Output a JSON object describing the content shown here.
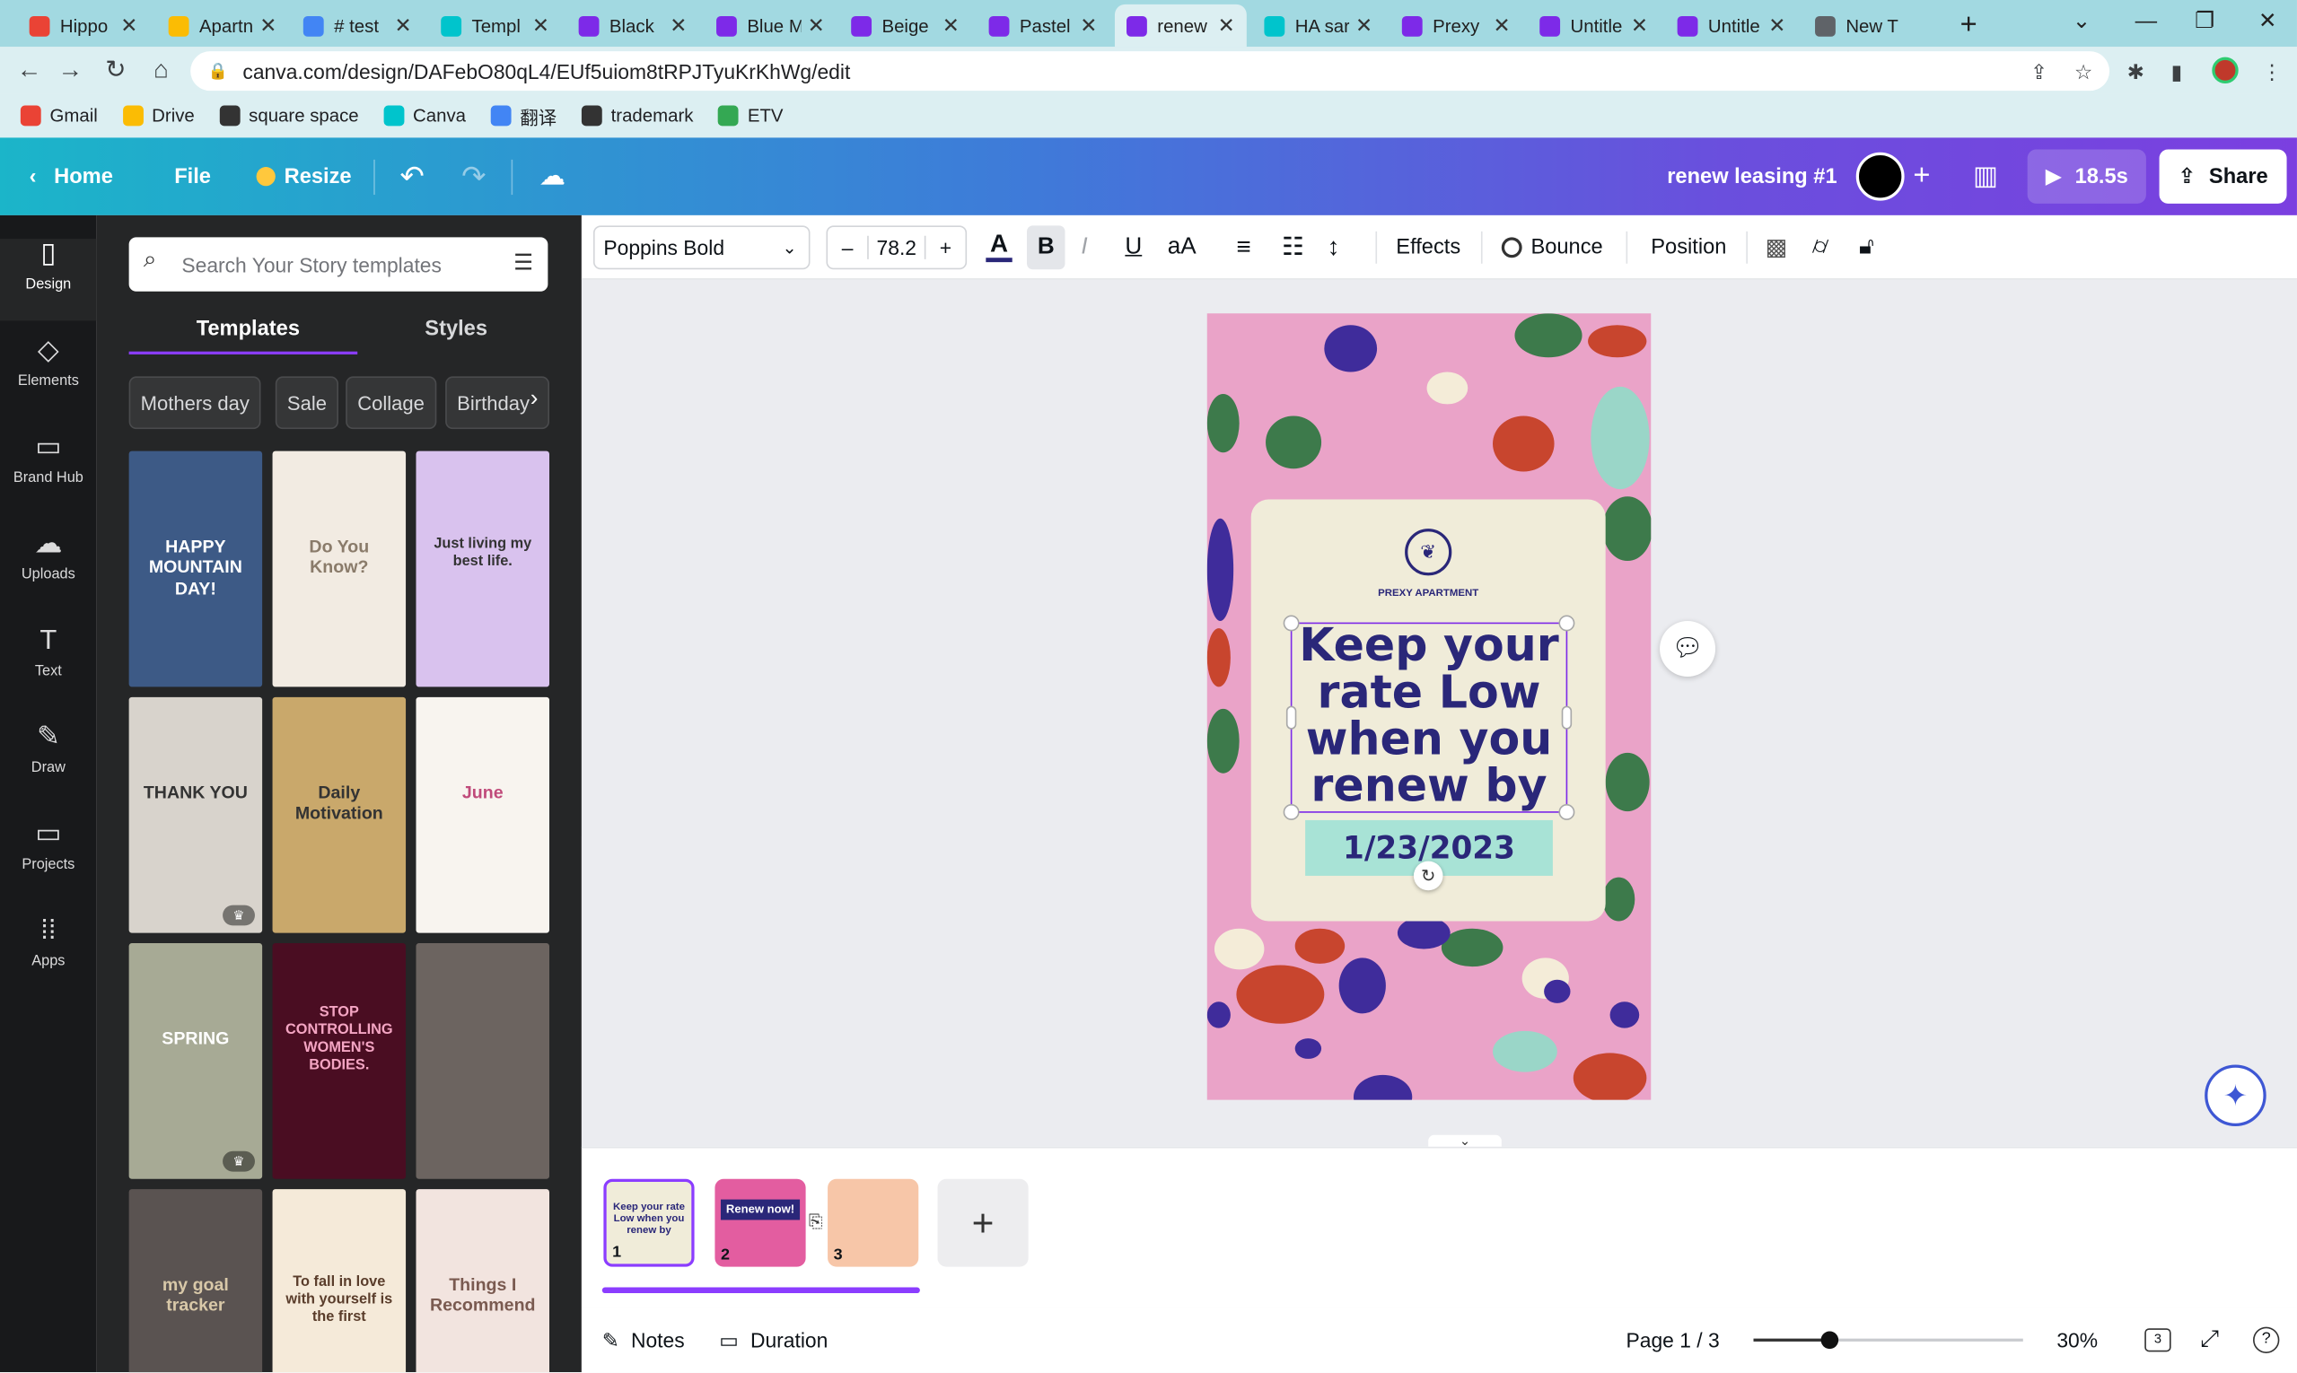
{
  "browser": {
    "tabs": [
      {
        "title": "Hippo",
        "icon": "gmail-icon",
        "color": "#ea4335"
      },
      {
        "title": "Apartn",
        "icon": "drive-icon",
        "color": "#fbbc04"
      },
      {
        "title": "# test",
        "icon": "docs-icon",
        "color": "#4285f4"
      },
      {
        "title": "Templ",
        "icon": "canva-icon",
        "color": "#00c4cc"
      },
      {
        "title": "Black",
        "icon": "canva-doc-icon",
        "color": "#7d2ae8"
      },
      {
        "title": "Blue M",
        "icon": "canva-doc-icon",
        "color": "#7d2ae8"
      },
      {
        "title": "Beige",
        "icon": "canva-doc-icon",
        "color": "#7d2ae8"
      },
      {
        "title": "Pastel",
        "icon": "canva-doc-icon",
        "color": "#7d2ae8"
      },
      {
        "title": "renew",
        "icon": "canva-design-icon",
        "color": "#7d2ae8"
      },
      {
        "title": "HA sar",
        "icon": "canva-icon",
        "color": "#00c4cc"
      },
      {
        "title": "Prexy",
        "icon": "canva-design-icon",
        "color": "#7d2ae8"
      },
      {
        "title": "Untitle",
        "icon": "canva-design-icon",
        "color": "#7d2ae8"
      },
      {
        "title": "Untitle",
        "icon": "canva-design-icon",
        "color": "#7d2ae8"
      },
      {
        "title": "New T",
        "icon": "chrome-icon",
        "color": "#5f6368"
      }
    ],
    "active_tab_index": 8,
    "url": "canva.com/design/DAFebO80qL4/EUf5uiom8tRPJTyuKrKhWg/edit",
    "bookmarks": [
      {
        "label": "Gmail",
        "color": "#ea4335"
      },
      {
        "label": "Drive",
        "color": "#fbbc04"
      },
      {
        "label": "square space",
        "color": "#333333"
      },
      {
        "label": "Canva",
        "color": "#00c4cc"
      },
      {
        "label": "翻译",
        "color": "#4285f4"
      },
      {
        "label": "trademark",
        "color": "#333333"
      },
      {
        "label": "ETV",
        "color": "#34a853"
      }
    ]
  },
  "header": {
    "home": "Home",
    "file": "File",
    "resize": "Resize",
    "design_title": "renew leasing #1",
    "play_duration": "18.5s",
    "share": "Share"
  },
  "rail": [
    {
      "label": "Design",
      "icon": "layout-icon",
      "glyph": "▯"
    },
    {
      "label": "Elements",
      "icon": "shapes-icon",
      "glyph": "◇"
    },
    {
      "label": "Brand Hub",
      "icon": "brand-icon",
      "glyph": "▭"
    },
    {
      "label": "Uploads",
      "icon": "cloud-upload-icon",
      "glyph": "☁"
    },
    {
      "label": "Text",
      "icon": "text-t-icon",
      "glyph": "T"
    },
    {
      "label": "Draw",
      "icon": "pen-icon",
      "glyph": "✎"
    },
    {
      "label": "Projects",
      "icon": "folder-icon",
      "glyph": "▭"
    },
    {
      "label": "Apps",
      "icon": "apps-grid-icon",
      "glyph": "⁞⁞"
    }
  ],
  "panel": {
    "search_placeholder": "Search Your Story templates",
    "tabs": [
      "Templates",
      "Styles"
    ],
    "chips": [
      "Mothers day",
      "Sale",
      "Collage",
      "Birthday"
    ],
    "templates": [
      {
        "name": "happy-mountain-day",
        "bg": "#3d5a86",
        "text": "HAPPY MOUNTAIN DAY!",
        "fg": "#ffffff",
        "crown": false
      },
      {
        "name": "do-you-know",
        "bg": "#f2ebe2",
        "text": "Do You Know?",
        "fg": "#8a7b6a",
        "crown": false
      },
      {
        "name": "just-living-my-best-life",
        "bg": "#d9c2ee",
        "text": "Just living my best life.",
        "fg": "#333333",
        "crown": false
      },
      {
        "name": "thank-you-my-friends",
        "bg": "#d8d3cc",
        "text": "THANK YOU",
        "fg": "#333333",
        "crown": true
      },
      {
        "name": "daily-motivation",
        "bg": "#c9a86b",
        "text": "Daily Motivation",
        "fg": "#333333",
        "crown": false
      },
      {
        "name": "june-calendar",
        "bg": "#f8f4ef",
        "text": "June",
        "fg": "#c04a7a",
        "crown": false
      },
      {
        "name": "spring-sale",
        "bg": "#a7aa95",
        "text": "SPRING",
        "fg": "#ffffff",
        "crown": true
      },
      {
        "name": "stop-controlling",
        "bg": "#4a0d22",
        "text": "STOP CONTROLLING WOMEN'S BODIES.",
        "fg": "#f4a5c3",
        "crown": false
      },
      {
        "name": "floral-quote",
        "bg": "#6c6460",
        "text": "",
        "fg": "#ffffff",
        "crown": false
      },
      {
        "name": "my-goal-tracker",
        "bg": "#5a5351",
        "text": "my goal tracker",
        "fg": "#d8c8a8",
        "crown": false
      },
      {
        "name": "fall-in-love",
        "bg": "#f5ead9",
        "text": "To fall in love with yourself is the first",
        "fg": "#5a3d2b",
        "crown": false
      },
      {
        "name": "things-i-recommend",
        "bg": "#f2e4df",
        "text": "Things I Recommend",
        "fg": "#7a5a50",
        "crown": false
      }
    ]
  },
  "toolbar": {
    "font": "Poppins Bold",
    "size": "78.2",
    "effects": "Effects",
    "animation": "Bounce",
    "position": "Position",
    "text_color": "#2a2779"
  },
  "canvas": {
    "brand": "PREXY APARTMENT",
    "headline": "Keep your rate Low when you renew by",
    "date": "1/23/2023",
    "page_bg": "#eaa3c8",
    "card_bg": "#f0ecd9",
    "accent": "#2a2779",
    "date_bg": "#a8e3d6"
  },
  "pages": [
    {
      "number": "1",
      "label": "Keep your rate Low when you renew by",
      "bg": "#f0ecd9"
    },
    {
      "number": "2",
      "label": "Renew now!",
      "bg": "#e35da0"
    },
    {
      "number": "3",
      "label": "",
      "bg": "#f7c6a8"
    }
  ],
  "footer": {
    "notes": "Notes",
    "duration": "Duration",
    "page_indicator": "Page 1 / 3",
    "zoom": "30%",
    "zoom_level": 0.3,
    "page_count_badge": "3"
  }
}
